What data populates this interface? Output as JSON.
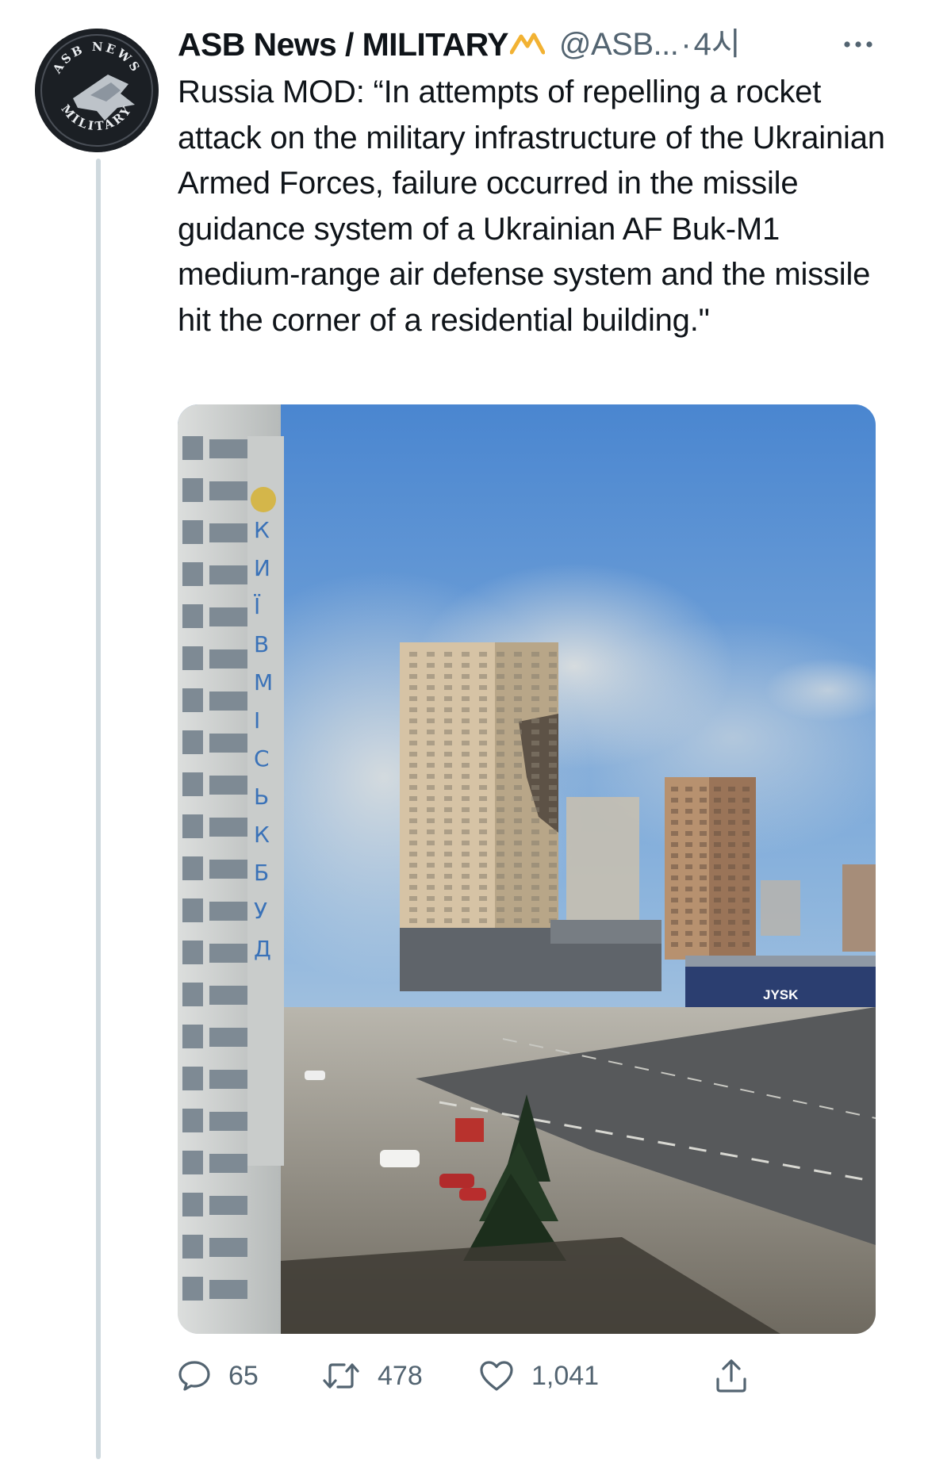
{
  "tweet": {
    "author": {
      "display_name": "ASB News / MILITARY",
      "handle": "@ASB...",
      "avatar_text_top": "ASB NEWS",
      "avatar_text_bottom": "MILITARY"
    },
    "separator": "·",
    "time": "4시",
    "more_label": "···",
    "text": "Russia MOD: “In attempts of repelling a rocket attack on the military infrastructure of the Ukrainian Armed Forces, failure occurred in the missile guidance system of a Ukrainian AF Buk-M1 medium-range air defense system and the missile hit the corner of a residential building.\"",
    "media": {
      "building_sign_letters": [
        "К",
        "И",
        "Ї",
        "В",
        "М",
        "І",
        "С",
        "Ь",
        "К",
        "Б",
        "У",
        "Д"
      ],
      "store_sign": "JYSK"
    },
    "actions": {
      "reply_count": "65",
      "retweet_count": "478",
      "like_count": "1,041"
    }
  },
  "colors": {
    "text_primary": "#0f1419",
    "text_secondary": "#536471",
    "thread_line": "#cfd9de",
    "verified_mark": "#f2b233",
    "sky_top": "#4a86d0",
    "sky_bottom": "#bcd2e6"
  },
  "icons": [
    "more-icon",
    "reply-icon",
    "retweet-icon",
    "like-icon",
    "share-icon",
    "mark-icon"
  ]
}
